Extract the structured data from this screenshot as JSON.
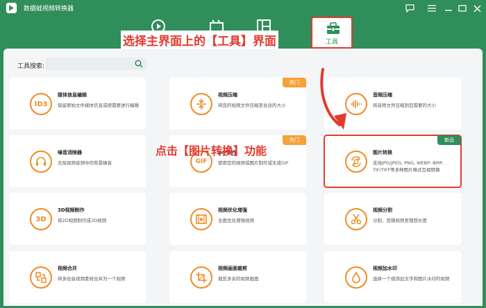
{
  "app": {
    "title": "数据蛙视频转换器"
  },
  "window_controls": [
    "message-icon",
    "menu-icon",
    "minimize-icon",
    "maximize-icon",
    "close-icon"
  ],
  "nav": {
    "tabs": [
      {
        "name": "convert",
        "icon": "convert-icon"
      },
      {
        "name": "mv",
        "icon": "film-icon"
      },
      {
        "name": "collage",
        "icon": "collage-icon"
      }
    ],
    "tool_tab_label": "工具"
  },
  "callouts": {
    "top": "选择主界面上的【工具】界面",
    "middle": "点击【图片转换】功能"
  },
  "search": {
    "label": "工具搜索:",
    "placeholder": ""
  },
  "cards": [
    {
      "title": "媒体信息编辑",
      "desc": "保留原始文件媒体信息或按需要进行编辑",
      "icon": "ID3",
      "badge": ""
    },
    {
      "title": "视频压缩",
      "desc": "将您的视频文件压缩至合适的大小",
      "icon": "compress-icon",
      "badge": "热门"
    },
    {
      "title": "音频压缩",
      "desc": "将音频文件压缩到您需要的大小",
      "icon": "audio-compress-icon",
      "badge": ""
    },
    {
      "title": "噪音消除器",
      "desc": "去除视频音频中的背景噪音",
      "icon": "headphone-icon",
      "badge": ""
    },
    {
      "title": "GIF制作",
      "desc": "使用您的视频或图片制作或生成GIF",
      "icon": "GIF",
      "badge": "热门"
    },
    {
      "title": "图片转换",
      "desc": "支持JPG/JPEG, PNG, WEBP, BMP, TIF/TIFF等多种图片格式互相转换",
      "icon": "image-convert-icon",
      "badge": "新品"
    },
    {
      "title": "3D视频制作",
      "desc": "将2D视频制作成3D视频",
      "icon": "3D",
      "badge": ""
    },
    {
      "title": "视频优化增强",
      "desc": "全面优化增强视频",
      "icon": "enhance-icon",
      "badge": ""
    },
    {
      "title": "视频分割",
      "desc": "分割、剪辑视频至理想长度",
      "icon": "scissors-icon",
      "badge": ""
    },
    {
      "title": "视频合并",
      "desc": "将多段音视频素材合并为一个视频",
      "icon": "merge-icon",
      "badge": ""
    },
    {
      "title": "视频画面裁剪",
      "desc": "裁剪多余的视频画面",
      "icon": "crop-icon",
      "badge": ""
    },
    {
      "title": "视频加水印",
      "desc": "选择一个感添加文字和图片水印的视频",
      "icon": "watermark-icon",
      "badge": ""
    }
  ],
  "colors": {
    "brand": "#2f8e5a",
    "accent": "#f08a24",
    "hot": "#f5a239",
    "annotation": "#e23b2e"
  }
}
